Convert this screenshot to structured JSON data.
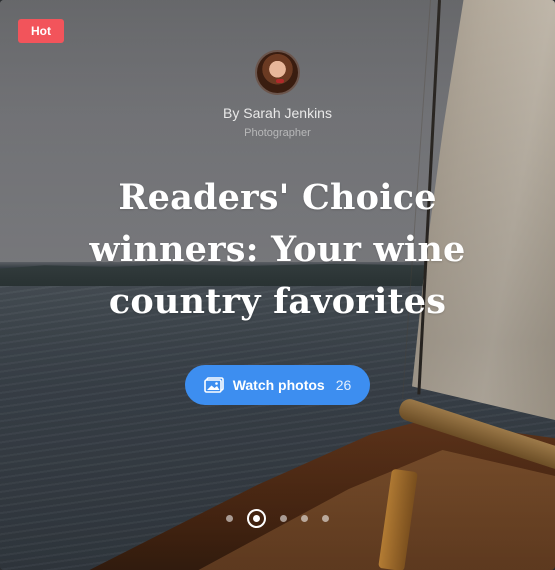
{
  "badge": {
    "label": "Hot",
    "color": "#f2545b"
  },
  "author": {
    "avatar": "author-avatar",
    "name": "By Sarah Jenkins",
    "role": "Photographer"
  },
  "headline": "Readers' Choice winners: Your wine country favorites",
  "cta": {
    "label": "Watch photos",
    "count": "26",
    "icon": "image-icon",
    "color": "#3d8ef0"
  },
  "pagination": {
    "total": 5,
    "active_index": 1
  }
}
